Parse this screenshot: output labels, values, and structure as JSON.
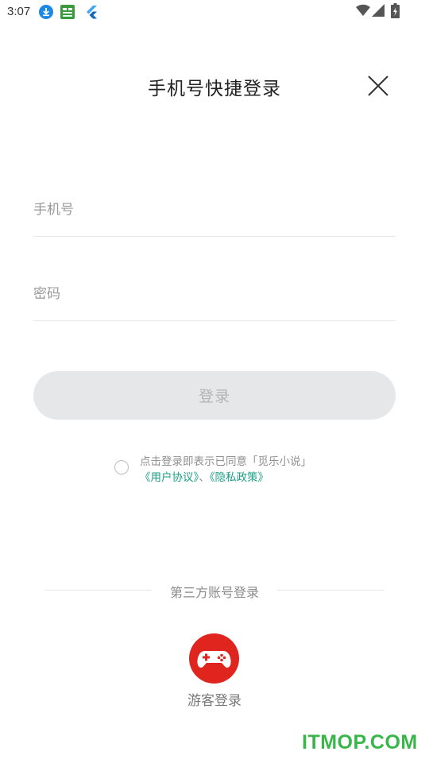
{
  "status_bar": {
    "time": "3:07",
    "icons": [
      "download-icon",
      "app-notification-icon",
      "flutter-icon",
      "wifi-icon",
      "signal-icon",
      "battery-icon"
    ]
  },
  "header": {
    "title": "手机号快捷登录",
    "close_icon": "close-icon"
  },
  "form": {
    "phone_placeholder": "手机号",
    "password_placeholder": "密码",
    "login_label": "登录"
  },
  "agreement": {
    "text": "点击登录即表示已同意「觅乐小说」",
    "user_agreement": "《用户协议》",
    "separator": "、",
    "privacy_policy": "《隐私政策》"
  },
  "third_party": {
    "title": "第三方账号登录",
    "guest_label": "游客登录"
  },
  "watermark": "ITMOP.COM",
  "colors": {
    "accent_link": "#1a9e86",
    "guest_red": "#e0251f",
    "button_disabled": "#e6e7e9"
  }
}
